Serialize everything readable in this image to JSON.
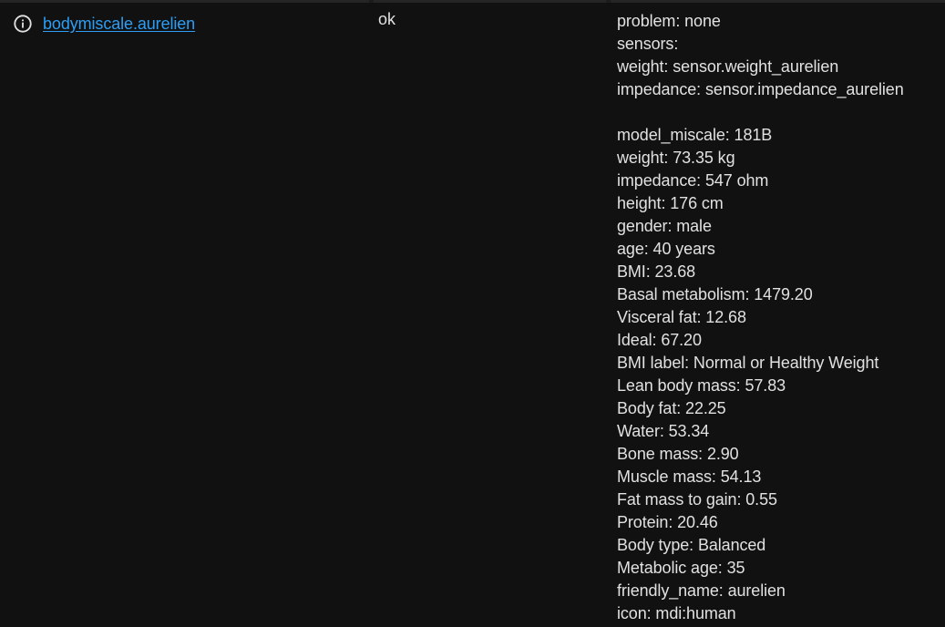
{
  "row": {
    "entity_id": "bodymiscale.aurelien",
    "state": "ok",
    "icon": "info-circle-icon"
  },
  "attributes_group1": [
    "problem: none",
    "sensors:",
    "weight: sensor.weight_aurelien",
    "impedance: sensor.impedance_aurelien"
  ],
  "attributes_group2": [
    "model_miscale: 181B",
    "weight: 73.35 kg",
    "impedance: 547 ohm",
    "height: 176 cm",
    "gender: male",
    "age: 40 years",
    "BMI: 23.68",
    "Basal metabolism: 1479.20",
    "Visceral fat: 12.68",
    "Ideal: 67.20",
    "BMI label: Normal or Healthy Weight",
    "Lean body mass: 57.83",
    "Body fat: 22.25",
    "Water: 53.34",
    "Bone mass: 2.90",
    "Muscle mass: 54.13",
    "Fat mass to gain: 0.55",
    "Protein: 20.46",
    "Body type: Balanced",
    "Metabolic age: 35",
    "friendly_name: aurelien",
    "icon: mdi:human"
  ]
}
